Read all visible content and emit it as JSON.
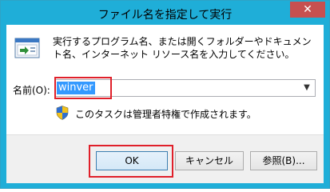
{
  "window": {
    "title": "ファイル名を指定して実行",
    "close_label": "✕"
  },
  "dialog": {
    "description": "実行するプログラム名、または開くフォルダーやドキュメント名、インターネット リソース名を入力してください。",
    "name_label": "名前(O):",
    "name_value": "winver",
    "admin_note": "このタスクは管理者特権で作成されます。"
  },
  "buttons": {
    "ok": "OK",
    "cancel": "キャンセル",
    "browse": "参照(B)..."
  },
  "icons": {
    "run": "run-dialog-icon",
    "shield": "uac-shield-icon",
    "dropdown": "chevron-down-icon"
  },
  "colors": {
    "titlebar": "#1faed8",
    "close": "#c75050",
    "selection": "#3399ff",
    "highlight_box": "#e0202a"
  }
}
